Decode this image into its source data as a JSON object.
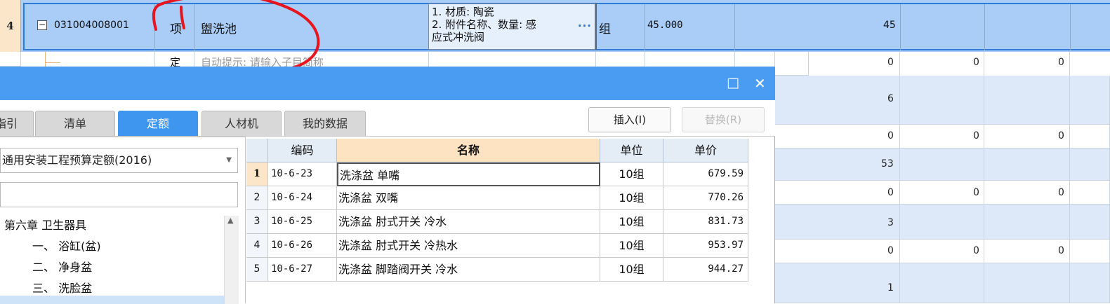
{
  "main_row": {
    "row_number": "4",
    "code": "031004008001",
    "type": "项",
    "name": "盥洗池",
    "description_lines": [
      "1. 材质: 陶瓷",
      "2. 附件名称、数量: 感",
      "应式冲洗阀"
    ],
    "unit": "组",
    "quantity": "45.000",
    "value": "45",
    "dots": "···"
  },
  "sub_row": {
    "type": "定",
    "hint": "自动提示: 请输入子目简称"
  },
  "background_values": {
    "col_a": [
      "0",
      "6",
      "0",
      "53",
      "0",
      "3",
      "0",
      "1"
    ],
    "col_b": [
      "0",
      "0",
      "0",
      "0"
    ],
    "col_c": [
      "0",
      "0",
      "0",
      "0"
    ]
  },
  "dialog": {
    "titlebar": {
      "maximize_icon": "□",
      "close_icon": "✕"
    },
    "tabs": [
      {
        "label": "指引",
        "active": false
      },
      {
        "label": "清单",
        "active": false
      },
      {
        "label": "定额",
        "active": true
      },
      {
        "label": "人材机",
        "active": false
      },
      {
        "label": "我的数据",
        "active": false
      }
    ],
    "buttons": {
      "insert": "插入(I)",
      "replace": "替换(R)"
    },
    "quota_library": "通用安装工程预算定额(2016)",
    "tree": [
      "第六章 卫生器具",
      "一、 浴缸(盆)",
      "二、 净身盆",
      "三、 洗脸盆"
    ],
    "table": {
      "headers": {
        "code": "编码",
        "name": "名称",
        "unit": "单位",
        "price": "单价"
      },
      "rows": [
        {
          "index": "1",
          "code": "10-6-23",
          "name": "洗涤盆 单嘴",
          "unit": "10组",
          "price": "679.59"
        },
        {
          "index": "2",
          "code": "10-6-24",
          "name": "洗涤盆 双嘴",
          "unit": "10组",
          "price": "770.26"
        },
        {
          "index": "3",
          "code": "10-6-25",
          "name": "洗涤盆 肘式开关 冷水",
          "unit": "10组",
          "price": "831.73"
        },
        {
          "index": "4",
          "code": "10-6-26",
          "name": "洗涤盆 肘式开关 冷热水",
          "unit": "10组",
          "price": "953.97"
        },
        {
          "index": "5",
          "code": "10-6-27",
          "name": "洗涤盆 脚踏阀开关 冷水",
          "unit": "10组",
          "price": "944.27"
        }
      ]
    }
  },
  "colors": {
    "selected_row": "#a9cdf6",
    "titlebar": "#4a9bf2",
    "active_tab": "#3f96ee",
    "annotation": "#e8141e"
  }
}
